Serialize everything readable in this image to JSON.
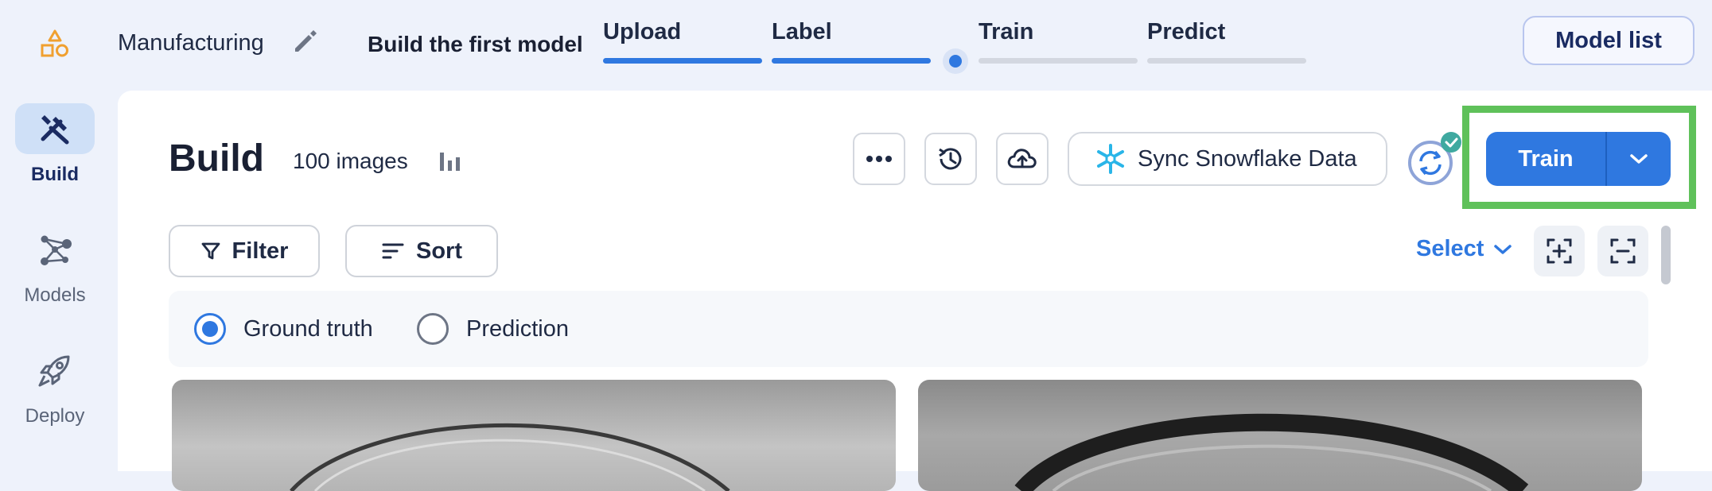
{
  "header": {
    "project_name": "Manufacturing",
    "build_title": "Build the first model",
    "steps": [
      {
        "label": "Upload",
        "state": "done"
      },
      {
        "label": "Label",
        "state": "done"
      },
      {
        "label": "Train",
        "state": "current"
      },
      {
        "label": "Predict",
        "state": "pending"
      }
    ],
    "model_list_label": "Model list"
  },
  "sidebar": {
    "items": [
      {
        "label": "Build",
        "icon": "tools-icon",
        "active": true
      },
      {
        "label": "Models",
        "icon": "network-icon",
        "active": false
      },
      {
        "label": "Deploy",
        "icon": "rocket-icon",
        "active": false
      }
    ]
  },
  "main": {
    "title": "Build",
    "image_count": "100 images",
    "sync_label": "Sync Snowflake Data",
    "train_label": "Train",
    "filter_label": "Filter",
    "sort_label": "Sort",
    "select_label": "Select",
    "view_options": [
      {
        "label": "Ground truth",
        "checked": true
      },
      {
        "label": "Prediction",
        "checked": false
      }
    ]
  },
  "colors": {
    "accent": "#2f78e0",
    "highlight": "#5fc15a",
    "logo": "#f0a030",
    "snowflake": "#29b5e8"
  }
}
